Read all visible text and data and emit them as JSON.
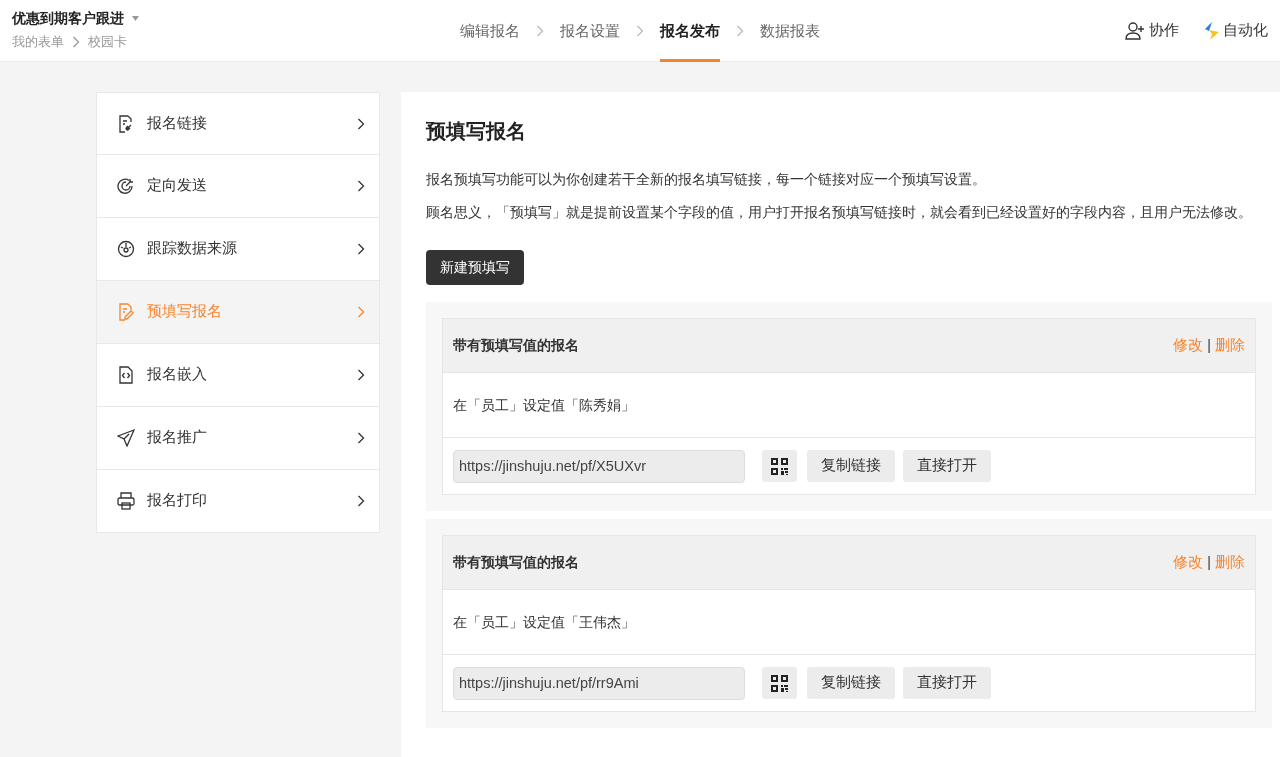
{
  "header": {
    "title": "优惠到期客户跟进",
    "breadcrumb": [
      "我的表单",
      "校园卡"
    ]
  },
  "steps": [
    {
      "label": "编辑报名",
      "selected": false
    },
    {
      "label": "报名设置",
      "selected": false
    },
    {
      "label": "报名发布",
      "selected": true
    },
    {
      "label": "数据报表",
      "selected": false
    }
  ],
  "actions": [
    {
      "label": "协作"
    },
    {
      "label": "自动化"
    }
  ],
  "sidebar": {
    "items": [
      {
        "label": "报名链接",
        "selected": false
      },
      {
        "label": "定向发送",
        "selected": false
      },
      {
        "label": "跟踪数据来源",
        "selected": false
      },
      {
        "label": "预填写报名",
        "selected": true
      },
      {
        "label": "报名嵌入",
        "selected": false
      },
      {
        "label": "报名推广",
        "selected": false
      },
      {
        "label": "报名打印",
        "selected": false
      }
    ]
  },
  "main": {
    "title": "预填写报名",
    "paragraphs": [
      "报名预填写功能可以为你创建若干全新的报名填写链接，每一个链接对应一个预填写设置。",
      "顾名思义，「预填写」就是提前设置某个字段的值，用户打开报名预填写链接时，就会看到已经设置好的字段内容，且用户无法修改。"
    ],
    "new_button": "新建预填写",
    "entries": [
      {
        "title": "带有预填写值的报名",
        "edit": "修改",
        "separator": "|",
        "delete": "删除",
        "description": "在「员工」设定值「陈秀娟」",
        "url": "https://jinshuju.net/pf/X5UXvr",
        "copy_button": "复制链接",
        "open_button": "直接打开"
      },
      {
        "title": "带有预填写值的报名",
        "edit": "修改",
        "separator": "|",
        "delete": "删除",
        "description": "在「员工」设定值「王伟杰」",
        "url": "https://jinshuju.net/pf/rr9Ami",
        "copy_button": "复制链接",
        "open_button": "直接打开"
      }
    ]
  }
}
